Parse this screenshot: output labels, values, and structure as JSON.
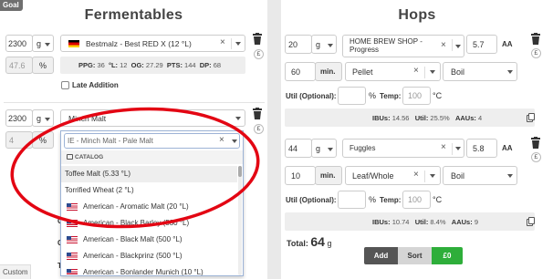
{
  "goal_label": "Goal",
  "custom_label": "Custom",
  "fermentables": {
    "title": "Fermentables",
    "row1": {
      "amount": "2300",
      "unit": "g",
      "flag": "de",
      "name": "Bestmalz - Best RED X (12 °L)",
      "percent": "47.6",
      "percent_unit": "%",
      "stats": {
        "ppg_label": "PPG:",
        "ppg": "36",
        "l_label": "°L:",
        "l": "12",
        "og_label": "OG:",
        "og": "27.29",
        "pts_label": "PTS:",
        "pts": "144",
        "dp_label": "DP:",
        "dp": "68"
      },
      "late_addition": "Late Addition"
    },
    "row2": {
      "amount": "2300",
      "unit": "g",
      "name": "Minch Malt",
      "percent_fragment": "4",
      "percent_unit": "%",
      "search": "IE - Minch Malt - Pale Malt",
      "obscured_left": [
        "C",
        "C",
        "T"
      ]
    },
    "dropdown": {
      "header": "CATALOG",
      "items": [
        {
          "label": "Toffee Malt (5.33 °L)",
          "flag": "",
          "highlight": true
        },
        {
          "label": "Torrified Wheat (2 °L)",
          "flag": "",
          "highlight": false
        },
        {
          "label": "American - Aromatic Malt (20 °L)",
          "flag": "us",
          "highlight": false
        },
        {
          "label": "American - Black Barley (530 °L)",
          "flag": "us",
          "highlight": false
        },
        {
          "label": "American - Black Malt (500 °L)",
          "flag": "us",
          "highlight": false
        },
        {
          "label": "American - Blackprinz (500 °L)",
          "flag": "us",
          "highlight": false
        },
        {
          "label": "American - Bonlander Munich (10 °L)",
          "flag": "us",
          "highlight": false
        }
      ]
    }
  },
  "hops": {
    "title": "Hops",
    "rows": [
      {
        "amount": "20",
        "unit": "g",
        "name": "HOME BREW SHOP - Progress",
        "aa": "5.7",
        "aa_label": "AA",
        "time": "60",
        "time_unit": "min.",
        "form": "Pellet",
        "use": "Boil",
        "util_label": "Util (Optional):",
        "util": "",
        "util_unit": "%",
        "temp_label": "Temp:",
        "temp": "100",
        "temp_unit": "°C",
        "ibus_label": "IBUs:",
        "ibus": "14.56",
        "util_stat_label": "Util:",
        "util_stat": "25.5%",
        "aaus_label": "AAUs:",
        "aaus": "4"
      },
      {
        "amount": "44",
        "unit": "g",
        "name": "Fuggles",
        "aa": "5.8",
        "aa_label": "AA",
        "time": "10",
        "time_unit": "min.",
        "form": "Leaf/Whole",
        "use": "Boil",
        "util_label": "Util (Optional):",
        "util": "",
        "util_unit": "%",
        "temp_label": "Temp:",
        "temp": "100",
        "temp_unit": "°C",
        "ibus_label": "IBUs:",
        "ibus": "10.74",
        "util_stat_label": "Util:",
        "util_stat": "8.4%",
        "aaus_label": "AAUs:",
        "aaus": "9"
      }
    ],
    "total_label": "Total:",
    "total_value": "64",
    "total_unit": "g",
    "buttons": {
      "add": "Add",
      "sort": "Sort",
      "cost": "£0"
    }
  },
  "colors": {
    "annotation": "#e30613",
    "add_button": "#555555",
    "sort_button": "#d5d5d5",
    "cost_button": "#2eae3a",
    "highlight": "#eeeeee"
  }
}
